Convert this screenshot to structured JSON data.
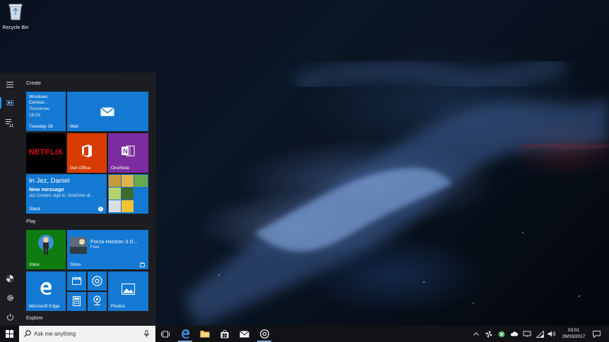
{
  "desktop": {
    "recycle_bin_label": "Recycle Bin"
  },
  "start_menu": {
    "groups": {
      "create": "Create",
      "play": "Play",
      "explore": "Explore"
    },
    "tiles": {
      "calendar": {
        "title": "Windows Central...",
        "event": "Tomorrow",
        "time": "16:00",
        "date": "Tuesday 28"
      },
      "mail": {
        "label": "Mail"
      },
      "netflix": {
        "logo": "NETFLIX"
      },
      "get_office": {
        "label": "Get Office"
      },
      "onenote": {
        "label": "OneNote"
      },
      "slack": {
        "header": "In Jez, Daniel",
        "title": "New message",
        "preview": "Jez Corden: sign in, OneDrive di...",
        "label": "Slack"
      },
      "xbox": {
        "label": "Xbox"
      },
      "store": {
        "game": "Forza Horizon 3 D...",
        "price": "Free",
        "label": "Store"
      },
      "edge": {
        "label": "Microsoft Edge"
      },
      "photos": {
        "label": "Photos"
      }
    }
  },
  "taskbar": {
    "search_placeholder": "Ask me anything",
    "clock": {
      "time": "03:01",
      "date": "28/03/2017"
    }
  },
  "colors": {
    "tile_blue": "#1479d2",
    "office_orange": "#d83b01",
    "onenote_purple": "#7b2c9e",
    "xbox_green": "#107c10",
    "netflix_red": "#e50914"
  }
}
